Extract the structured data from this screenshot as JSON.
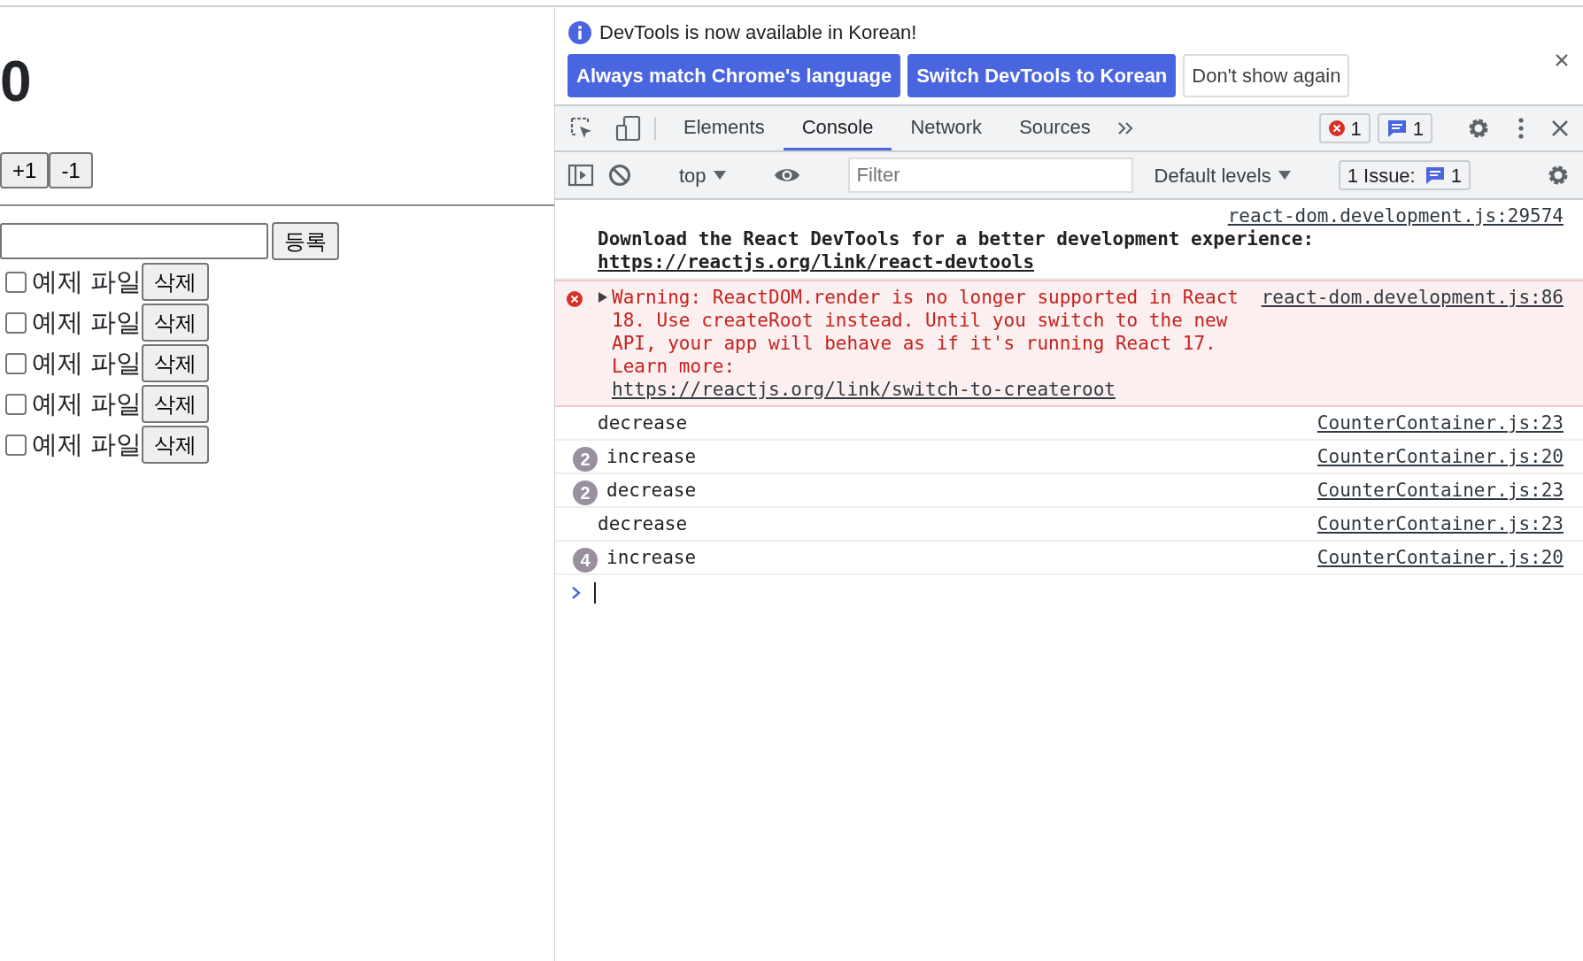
{
  "app": {
    "counter": "0",
    "buttons": [
      "+1",
      "-1"
    ],
    "register_button": "등록",
    "todos": [
      {
        "text": "예제 파일",
        "checked": false,
        "delete_button": "삭제"
      },
      {
        "text": "예제 파일",
        "checked": false,
        "delete_button": "삭제"
      },
      {
        "text": "예제 파일",
        "checked": false,
        "delete_button": "삭제"
      },
      {
        "text": "예제 파일",
        "checked": false,
        "delete_button": "삭제"
      },
      {
        "text": "예제 파일",
        "checked": false,
        "delete_button": "삭제"
      }
    ]
  },
  "devtools": {
    "infobar": {
      "message": "DevTools is now available in Korean!",
      "buttons": [
        {
          "label": "Always match Chrome's language",
          "kind": "primary"
        },
        {
          "label": "Switch DevTools to Korean",
          "kind": "primary"
        },
        {
          "label": "Don't show again",
          "kind": "secondary"
        }
      ]
    },
    "tabs": [
      {
        "label": "Elements",
        "selected": false
      },
      {
        "label": "Console",
        "selected": true
      },
      {
        "label": "Network",
        "selected": false
      },
      {
        "label": "Sources",
        "selected": false
      }
    ],
    "error_count": "1",
    "message_count": "1",
    "console_toolbar": {
      "context": "top",
      "filter": {
        "placeholder": "Filter"
      },
      "levels": "Default levels",
      "issues_label": "1 Issue:",
      "issues_count": "1"
    },
    "messages": [
      {
        "kind": "info",
        "text": "Download the React DevTools for a better development experience:",
        "url": "https://reactjs.org/link/react-devtools",
        "source": "react-dom.development.js:29574"
      },
      {
        "kind": "error",
        "text": "Warning: ReactDOM.render is no longer supported in React 18. Use createRoot instead. Until you switch to the new API, your app will behave as if it's running React 17. Learn more:",
        "url": "https://reactjs.org/link/switch-to-createroot",
        "source": "react-dom.development.js:86"
      },
      {
        "kind": "log",
        "text": "decrease",
        "source": "CounterContainer.js:23"
      },
      {
        "kind": "log",
        "count": "2",
        "text": "increase",
        "source": "CounterContainer.js:20"
      },
      {
        "kind": "log",
        "count": "2",
        "text": "decrease",
        "source": "CounterContainer.js:23"
      },
      {
        "kind": "log",
        "text": "decrease",
        "source": "CounterContainer.js:23"
      },
      {
        "kind": "log",
        "count": "4",
        "text": "increase",
        "source": "CounterContainer.js:20"
      }
    ]
  }
}
